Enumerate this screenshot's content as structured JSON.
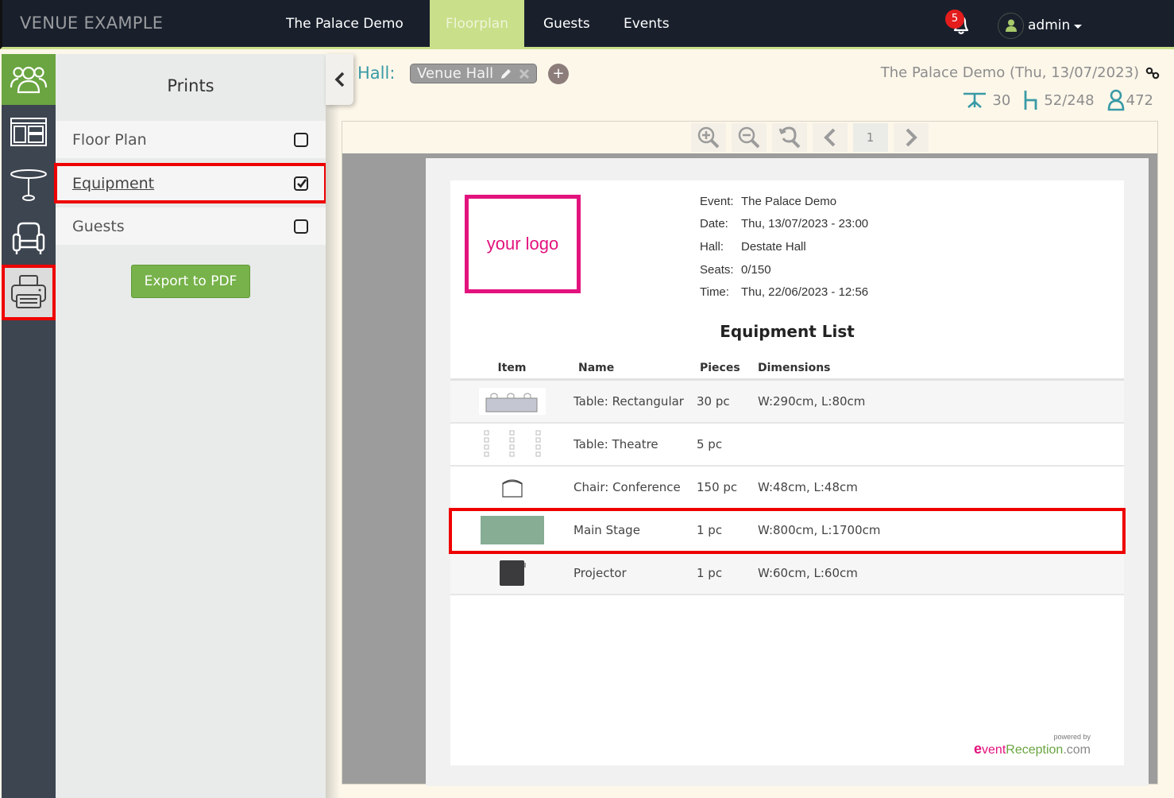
{
  "app": {
    "brand": "VENUE EXAMPLE",
    "nav": [
      {
        "label": "The Palace Demo",
        "active": false
      },
      {
        "label": "Floorplan",
        "active": true
      },
      {
        "label": "Guests",
        "active": false
      },
      {
        "label": "Events",
        "active": false
      }
    ],
    "notifications_count": "5",
    "user_name": "admin",
    "accent_color": "#c9df8a"
  },
  "rail": [
    {
      "icon": "guests-group-icon",
      "active": true
    },
    {
      "icon": "layout-icon",
      "active": false
    },
    {
      "icon": "round-table-icon",
      "active": false
    },
    {
      "icon": "armchair-icon",
      "active": false
    },
    {
      "icon": "printer-icon",
      "active": false,
      "selected": true
    }
  ],
  "prints": {
    "title": "Prints",
    "options": [
      {
        "label": "Floor Plan",
        "checked": false
      },
      {
        "label": "Equipment",
        "checked": true
      },
      {
        "label": "Guests",
        "checked": false
      }
    ],
    "export_label": "Export to PDF"
  },
  "hall": {
    "label": "Hall:",
    "current": "Venue Hall",
    "add_label": "+"
  },
  "event_header": {
    "title": "The Palace Demo (Thu, 13/07/2023)",
    "tables": "30",
    "seats": "52/248",
    "guests": "472"
  },
  "viewer": {
    "page_number": "1"
  },
  "document": {
    "logo_text": "your logo",
    "meta": [
      {
        "key": "Event:",
        "value": "The Palace Demo"
      },
      {
        "key": "Date:",
        "value": "Thu, 13/07/2023 - 23:00"
      },
      {
        "key": "Hall:",
        "value": "Destate Hall"
      },
      {
        "key": "Seats:",
        "value": "0/150"
      },
      {
        "key": "Time:",
        "value": "Thu, 22/06/2023 - 12:56"
      }
    ],
    "title": "Equipment List",
    "columns": [
      "Item",
      "Name",
      "Pieces",
      "Dimensions"
    ],
    "rows": [
      {
        "icon": "rectangular-table-icon",
        "name": "Table: Rectangular",
        "pieces": "30 pc",
        "dimensions": "W:290cm, L:80cm"
      },
      {
        "icon": "theatre-table-icon",
        "name": "Table: Theatre",
        "pieces": "5 pc",
        "dimensions": ""
      },
      {
        "icon": "conference-chair-icon",
        "name": "Chair: Conference",
        "pieces": "150 pc",
        "dimensions": "W:48cm, L:48cm"
      },
      {
        "icon": "stage-icon",
        "name": "Main Stage",
        "pieces": "1 pc",
        "dimensions": "W:800cm, L:1700cm",
        "highlighted": true
      },
      {
        "icon": "projector-icon",
        "name": "Projector",
        "pieces": "1 pc",
        "dimensions": "W:60cm, L:60cm"
      }
    ],
    "powered_by": "powered by",
    "powered_brand_e": "e",
    "powered_brand_vent": "vent",
    "powered_brand_reception": "Reception",
    "powered_brand_com": ".com"
  }
}
